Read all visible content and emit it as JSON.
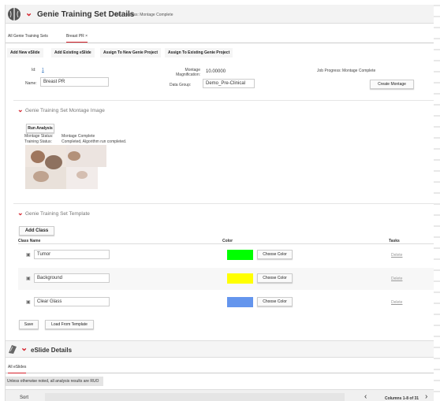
{
  "header": {
    "title": "Genie Training Set Details",
    "subtitle": "Job Progress: Montage Complete"
  },
  "tabs": [
    {
      "label": "All Genie Training Sets"
    },
    {
      "label": "Breast PR ×"
    }
  ],
  "toolbar": {
    "add_new": "Add New eSlide",
    "add_existing": "Add Existing eSlide",
    "assign_new": "Assign To New Genie Project",
    "assign_existing": "Assign To Existing Genie Project"
  },
  "form": {
    "id_label": "Id:",
    "id_value": "1",
    "name_label": "Name:",
    "name_value": "Breast PR",
    "mag_label": "Montage Magnification:",
    "mag_value": "10.00000",
    "group_label": "Data Group:",
    "group_value": "Demo_Pre-Clinical",
    "job_label": "Job Progress:",
    "job_value": "Montage Complete",
    "create_montage": "Create Montage"
  },
  "montage": {
    "heading": "Genie Training Set Montage Image",
    "run_analysis": "Run Analysis",
    "montage_status_label": "Montage Status:",
    "montage_status_value": "Montage Complete",
    "training_status_label": "Training Status:",
    "training_status_value": "Completed, Algorithm run completed."
  },
  "template": {
    "heading": "Genie Training Set Template",
    "add_class": "Add Class",
    "col_class": "Class Name",
    "col_color": "Color",
    "col_tasks": "Tasks",
    "choose_color": "Choose Color",
    "delete": "Delete",
    "rows": [
      {
        "name": "Tumor",
        "color": "#00ff00"
      },
      {
        "name": "Background",
        "color": "#ffff00"
      },
      {
        "name": "Clear Glass",
        "color": "#6495ed"
      }
    ],
    "save": "Save",
    "load": "Load From Template"
  },
  "eslide": {
    "heading": "eSlide Details",
    "tab": "All eSlides",
    "notice": "Unless otherwise noted, all analysis results are RUO",
    "sort": "Sort",
    "columns": "Columns 1-8 of 31"
  },
  "colors": {
    "accent": "#d4202a"
  }
}
